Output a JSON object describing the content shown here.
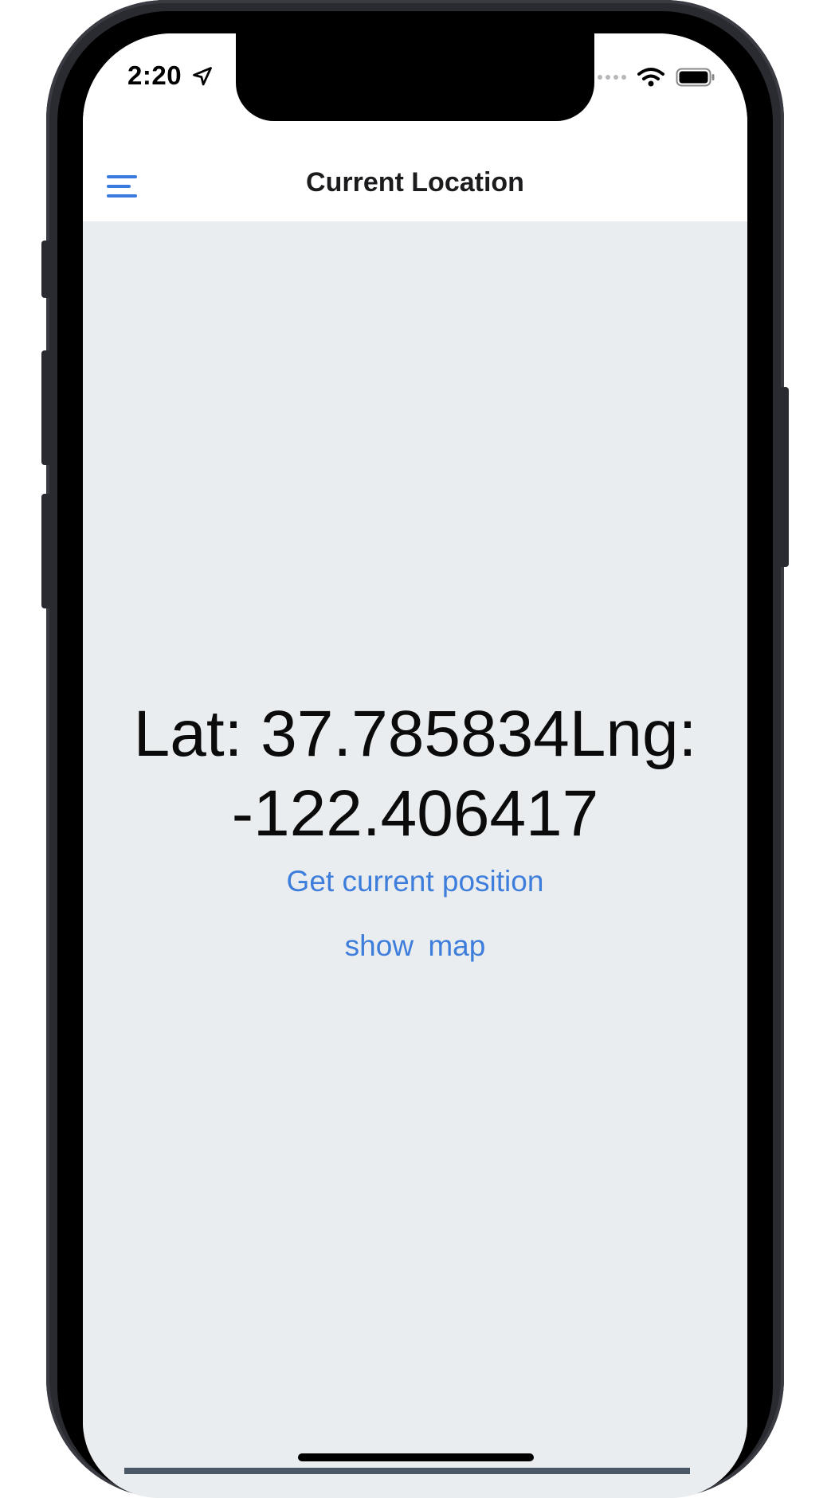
{
  "status_bar": {
    "time": "2:20",
    "location_icon": "location-arrow-icon",
    "signal_icon": "cellular-dots-icon",
    "wifi_icon": "wifi-icon",
    "battery_icon": "battery-icon"
  },
  "nav": {
    "menu_icon": "hamburger-menu-icon",
    "title": "Current Location"
  },
  "main": {
    "coordinates_text": "Lat: 37.785834Lng: -122.406417",
    "get_position_label": "Get current position",
    "show_map_label": "show  map"
  },
  "colors": {
    "accent": "#3d7ddb",
    "content_background": "#eaedef",
    "nav_background": "#ffffff",
    "text_primary": "#0b0b0b"
  }
}
